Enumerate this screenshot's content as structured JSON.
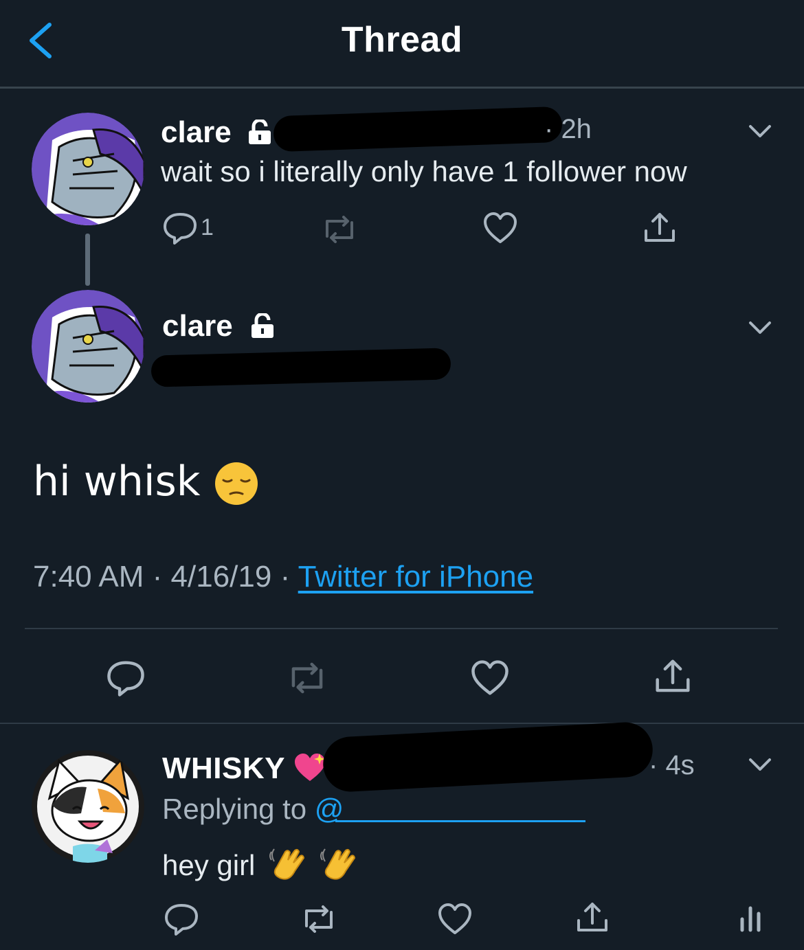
{
  "header": {
    "title": "Thread"
  },
  "tweet1": {
    "name": "clare",
    "time": "2h",
    "text": "wait so i literally only have 1 follower now",
    "reply_count": "1"
  },
  "tweet2": {
    "name": "clare",
    "text": "hi whisk",
    "time": "7:40 AM",
    "date": "4/16/19",
    "source": "Twitter for iPhone"
  },
  "reply": {
    "name": "WHISKY",
    "time": "4s",
    "replying_label": "Replying to",
    "replying_handle": "@",
    "text": "hey girl"
  },
  "colors": {
    "background": "#141d26",
    "accent": "#1da1f2",
    "muted": "#aab6c1"
  },
  "icons": [
    "back-icon",
    "lock-icon",
    "chevron-down-icon",
    "reply-icon",
    "retweet-icon",
    "like-icon",
    "share-icon",
    "analytics-icon"
  ]
}
